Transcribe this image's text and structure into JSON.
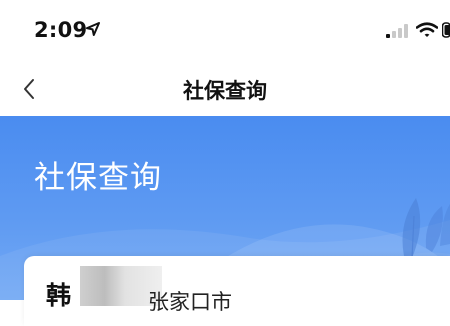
{
  "status_bar": {
    "time": "2:09",
    "location_icon": "location-arrow-icon",
    "signal_icon": "cellular-signal-icon",
    "wifi_icon": "wifi-icon",
    "battery_icon": "battery-icon"
  },
  "nav": {
    "back_icon": "chevron-left-icon",
    "title": "社保查询"
  },
  "hero": {
    "title": "社保查询",
    "gradient_top": "#4a8cf0",
    "gradient_bottom": "#73a9f4"
  },
  "card": {
    "name": "韩",
    "city": "张家口市"
  }
}
